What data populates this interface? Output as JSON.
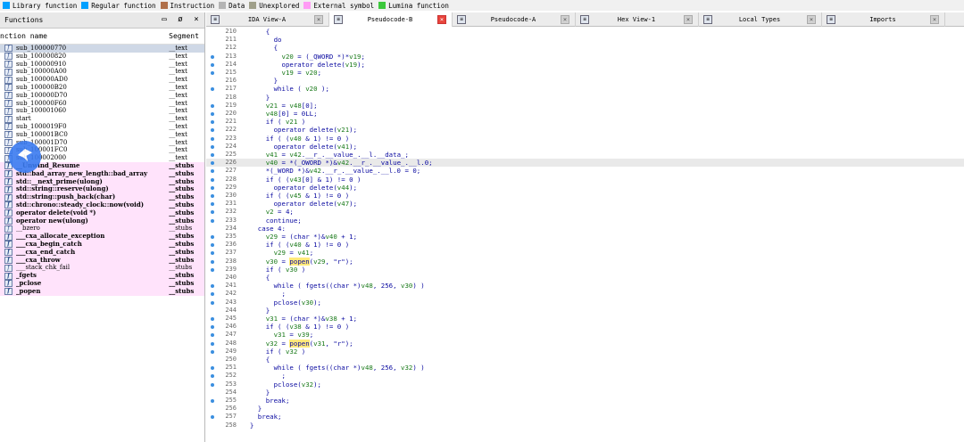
{
  "legend": [
    {
      "label": "Library function",
      "color": "#00a0ff"
    },
    {
      "label": "Regular function",
      "color": "#00a0ff"
    },
    {
      "label": "Instruction",
      "color": "#b0704a"
    },
    {
      "label": "Data",
      "color": "#b4b4b4"
    },
    {
      "label": "Unexplored",
      "color": "#a0a08a"
    },
    {
      "label": "External symbol",
      "color": "#ff9cf5"
    },
    {
      "label": "Lumina function",
      "color": "#3cc83c"
    }
  ],
  "functions_panel": {
    "title": "Functions",
    "col_name": "nction name",
    "col_segment": "Segment",
    "rows": [
      {
        "name": "sub_100000770",
        "seg": "__text",
        "kind": "sel"
      },
      {
        "name": "sub_100000820",
        "seg": "__text",
        "kind": "plain"
      },
      {
        "name": "sub_100000910",
        "seg": "__text",
        "kind": "plain"
      },
      {
        "name": "sub_100000A00",
        "seg": "__text",
        "kind": "plain"
      },
      {
        "name": "sub_100000AD0",
        "seg": "__text",
        "kind": "plain"
      },
      {
        "name": "sub_100000B20",
        "seg": "__text",
        "kind": "plain"
      },
      {
        "name": "sub_100000D70",
        "seg": "__text",
        "kind": "plain"
      },
      {
        "name": "sub_100000F60",
        "seg": "__text",
        "kind": "plain"
      },
      {
        "name": "sub_100001060",
        "seg": "__text",
        "kind": "plain"
      },
      {
        "name": "start",
        "seg": "__text",
        "kind": "plain"
      },
      {
        "name": "sub_1000019F0",
        "seg": "__text",
        "kind": "plain"
      },
      {
        "name": "sub_100001BC0",
        "seg": "__text",
        "kind": "plain"
      },
      {
        "name": "sub_100001D70",
        "seg": "__text",
        "kind": "plain"
      },
      {
        "name": "sub_100001FC0",
        "seg": "__text",
        "kind": "plain"
      },
      {
        "name": "sub_100002000",
        "seg": "__text",
        "kind": "plain"
      },
      {
        "name": "__Unwind_Resume",
        "seg": "__stubs",
        "kind": "lib"
      },
      {
        "name": "std::bad_array_new_length::bad_array",
        "seg": "__stubs",
        "kind": "lib"
      },
      {
        "name": "std::__next_prime(ulong)",
        "seg": "__stubs",
        "kind": "lib"
      },
      {
        "name": "std::string::reserve(ulong)",
        "seg": "__stubs",
        "kind": "lib"
      },
      {
        "name": "std::string::push_back(char)",
        "seg": "__stubs",
        "kind": "lib"
      },
      {
        "name": "std::chrono::steady_clock::now(void)",
        "seg": "__stubs",
        "kind": "lib"
      },
      {
        "name": "operator delete(void *)",
        "seg": "__stubs",
        "kind": "lib"
      },
      {
        "name": "operator new(ulong)",
        "seg": "__stubs",
        "kind": "lib"
      },
      {
        "name": "__bzero",
        "seg": "__stubs",
        "kind": "libn"
      },
      {
        "name": "___cxa_allocate_exception",
        "seg": "__stubs",
        "kind": "lib"
      },
      {
        "name": "___cxa_begin_catch",
        "seg": "__stubs",
        "kind": "lib"
      },
      {
        "name": "___cxa_end_catch",
        "seg": "__stubs",
        "kind": "lib"
      },
      {
        "name": "___cxa_throw",
        "seg": "__stubs",
        "kind": "lib"
      },
      {
        "name": "___stack_chk_fail",
        "seg": "__stubs",
        "kind": "libn"
      },
      {
        "name": "_fgets",
        "seg": "__stubs",
        "kind": "lib"
      },
      {
        "name": "_pclose",
        "seg": "__stubs",
        "kind": "lib"
      },
      {
        "name": "_popen",
        "seg": "__stubs",
        "kind": "lib"
      }
    ]
  },
  "tabs": [
    {
      "label": "IDA View-A",
      "width": 138,
      "active": false
    },
    {
      "label": "Pseudocode-B",
      "width": 138,
      "active": true
    },
    {
      "label": "Pseudocode-A",
      "width": 138,
      "active": false
    },
    {
      "label": "Hex View-1",
      "width": 138,
      "active": false
    },
    {
      "label": "Local Types",
      "width": 138,
      "active": false
    },
    {
      "label": "Imports",
      "width": 138,
      "active": false
    }
  ],
  "code_lines": [
    {
      "n": "210",
      "dot": false,
      "t": "      {"
    },
    {
      "n": "211",
      "dot": false,
      "t": "        do"
    },
    {
      "n": "212",
      "dot": false,
      "t": "        {"
    },
    {
      "n": "213",
      "dot": true,
      "t": "          v20 = (_QWORD *)*v19;"
    },
    {
      "n": "214",
      "dot": true,
      "t": "          operator delete(v19);"
    },
    {
      "n": "215",
      "dot": true,
      "t": "          v19 = v20;"
    },
    {
      "n": "216",
      "dot": false,
      "t": "        }"
    },
    {
      "n": "217",
      "dot": true,
      "t": "        while ( v20 );"
    },
    {
      "n": "218",
      "dot": false,
      "t": "      }"
    },
    {
      "n": "219",
      "dot": true,
      "t": "      v21 = v48[0];"
    },
    {
      "n": "220",
      "dot": true,
      "t": "      v48[0] = 0LL;"
    },
    {
      "n": "221",
      "dot": true,
      "t": "      if ( v21 )"
    },
    {
      "n": "222",
      "dot": true,
      "t": "        operator delete(v21);"
    },
    {
      "n": "223",
      "dot": true,
      "t": "      if ( (v40 & 1) != 0 )"
    },
    {
      "n": "224",
      "dot": true,
      "t": "        operator delete(v41);"
    },
    {
      "n": "225",
      "dot": true,
      "t": "      v41 = v42.__r_.__value_.__l.__data_;"
    },
    {
      "n": "226",
      "dot": true,
      "t": "      v40 = *(_OWORD *)&v42.__r_.__value_.__l.0;",
      "hl": true
    },
    {
      "n": "227",
      "dot": true,
      "t": "      *(_WORD *)&v42.__r_.__value_.__l.0 = 0;"
    },
    {
      "n": "228",
      "dot": true,
      "t": "      if ( (v43[0] & 1) != 0 )"
    },
    {
      "n": "229",
      "dot": true,
      "t": "        operator delete(v44);"
    },
    {
      "n": "230",
      "dot": true,
      "t": "      if ( (v45 & 1) != 0 )"
    },
    {
      "n": "231",
      "dot": true,
      "t": "        operator delete(v47);"
    },
    {
      "n": "232",
      "dot": true,
      "t": "      v2 = 4;"
    },
    {
      "n": "233",
      "dot": true,
      "t": "      continue;"
    },
    {
      "n": "234",
      "dot": false,
      "t": "    case 4:"
    },
    {
      "n": "235",
      "dot": true,
      "t": "      v29 = (char *)&v40 + 1;"
    },
    {
      "n": "236",
      "dot": true,
      "t": "      if ( (v40 & 1) != 0 )"
    },
    {
      "n": "237",
      "dot": true,
      "t": "        v29 = v41;"
    },
    {
      "n": "238",
      "dot": true,
      "t": "      v30 = popen(v29, \"r\");",
      "word": "popen"
    },
    {
      "n": "239",
      "dot": true,
      "t": "      if ( v30 )"
    },
    {
      "n": "240",
      "dot": false,
      "t": "      {"
    },
    {
      "n": "241",
      "dot": true,
      "t": "        while ( fgets((char *)v48, 256, v30) )"
    },
    {
      "n": "242",
      "dot": true,
      "t": "          ;"
    },
    {
      "n": "243",
      "dot": true,
      "t": "        pclose(v30);"
    },
    {
      "n": "244",
      "dot": false,
      "t": "      }"
    },
    {
      "n": "245",
      "dot": true,
      "t": "      v31 = (char *)&v38 + 1;"
    },
    {
      "n": "246",
      "dot": true,
      "t": "      if ( (v38 & 1) != 0 )"
    },
    {
      "n": "247",
      "dot": true,
      "t": "        v31 = v39;"
    },
    {
      "n": "248",
      "dot": true,
      "t": "      v32 = popen(v31, \"r\");",
      "word": "popen"
    },
    {
      "n": "249",
      "dot": true,
      "t": "      if ( v32 )"
    },
    {
      "n": "250",
      "dot": false,
      "t": "      {"
    },
    {
      "n": "251",
      "dot": true,
      "t": "        while ( fgets((char *)v48, 256, v32) )"
    },
    {
      "n": "252",
      "dot": true,
      "t": "          ;"
    },
    {
      "n": "253",
      "dot": true,
      "t": "        pclose(v32);"
    },
    {
      "n": "254",
      "dot": false,
      "t": "      }"
    },
    {
      "n": "255",
      "dot": true,
      "t": "      break;"
    },
    {
      "n": "256",
      "dot": false,
      "t": "    }"
    },
    {
      "n": "257",
      "dot": true,
      "t": "    break;"
    },
    {
      "n": "258",
      "dot": false,
      "t": "  }"
    }
  ]
}
